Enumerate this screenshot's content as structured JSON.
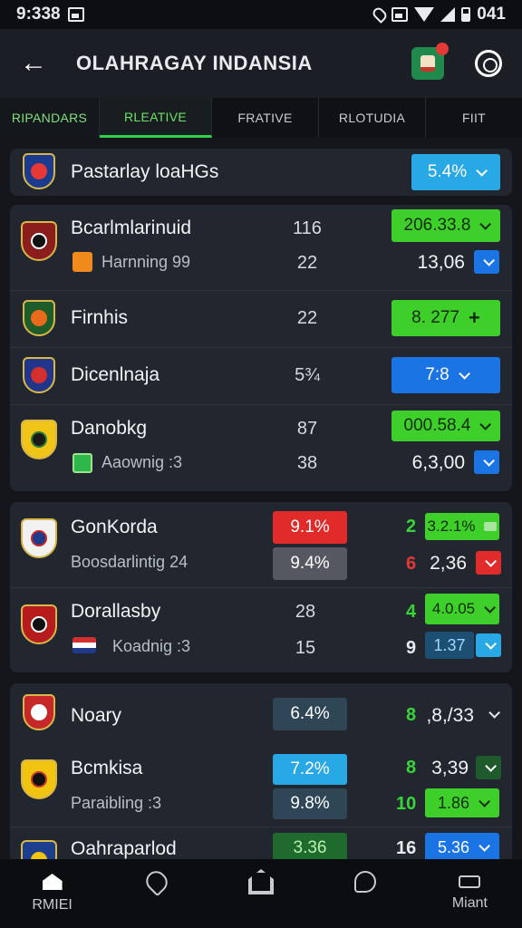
{
  "status_bar": {
    "time": "9:338",
    "battery": "041"
  },
  "app_bar": {
    "title": "OLAHRAGAY INDANSIA"
  },
  "tabs": [
    {
      "label": "RIPANDARS",
      "active": false
    },
    {
      "label": "RLEATIVE",
      "active": true
    },
    {
      "label": "FRATIVE",
      "active": false
    },
    {
      "label": "RLOTUDIA",
      "active": false
    },
    {
      "label": "FIIT",
      "active": false
    }
  ],
  "featured": {
    "name": "Pastarlay loaHGs",
    "pill": "5.4%"
  },
  "group1": {
    "rows": [
      {
        "name": "Bcarlmlarinuid",
        "number": "116",
        "pill": "206.33.8",
        "sub_label": "Harnning 99",
        "sub_number": "22",
        "sub_value": "13,06"
      },
      {
        "name": "Firnhis",
        "number": "22",
        "pill": "8. 277"
      },
      {
        "name": "Dicenlnaja",
        "number": "5¾",
        "pill": "7:8"
      },
      {
        "name": "Danobkg",
        "number": "87",
        "pill": "000.58.4",
        "sub_label": "Aaownig :3",
        "sub_number": "38",
        "sub_value": "6,3,00"
      }
    ]
  },
  "group2": {
    "rows": [
      {
        "name": "GonKorda",
        "pill": "9.1%",
        "lead": "2",
        "value_pill": "3.2.1%",
        "sub_label": "Boosdarlintig 24",
        "sub_pill": "9.4%",
        "sub_lead": "6",
        "sub_value": "2,36"
      },
      {
        "name": "Dorallasby",
        "number": "28",
        "lead": "4",
        "value_pill": "4.0.05",
        "sub_label": "Koadnig :3",
        "sub_number": "15",
        "sub_lead": "9",
        "sub_value_pill": "1.37"
      }
    ]
  },
  "group3": {
    "rows": [
      {
        "name": "Noary",
        "pill": "6.4%",
        "lead": "8",
        "value": ",8,/33"
      },
      {
        "name": "Bcmkisa",
        "pill": "7.2%",
        "lead": "8",
        "value": "3,39",
        "sub_label": "Paraibling :3",
        "sub_pill": "9.8%",
        "sub_lead": "10",
        "sub_value_pill": "1.86"
      },
      {
        "name": "Oahraparlod",
        "pill": "3.36",
        "lead": "16",
        "value_pill": "5.36"
      }
    ]
  },
  "bottom_nav": [
    {
      "label": "RMIEI",
      "icon": "home-icon"
    },
    {
      "label": "",
      "icon": "heart-icon"
    },
    {
      "label": "",
      "icon": "house-outline-icon"
    },
    {
      "label": "",
      "icon": "chat-icon"
    },
    {
      "label": "Miant",
      "icon": "menu-icon"
    }
  ],
  "colors": {
    "accent_green": "#3fcf2a",
    "accent_blue": "#1b74e4",
    "accent_red": "#e12b2b",
    "background": "#14161c"
  }
}
